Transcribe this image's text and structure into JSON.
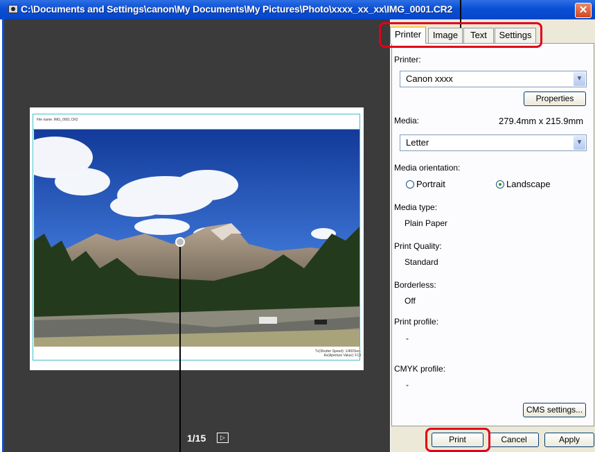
{
  "window": {
    "title": "C:\\Documents and Settings\\canon\\My Documents\\My Pictures\\Photo\\xxxx_xx_xx\\IMG_0001.CR2",
    "close_glyph": "✕"
  },
  "preview": {
    "sheet_header": "File name: IMG_0001.CR2",
    "exif_line1": "Tv(Shutter Speed): 1/400Sec.",
    "exif_line2": "Av(Aperture Value): F13",
    "pager_text": "1/15",
    "next_glyph": "▷"
  },
  "tabs": [
    {
      "label": "Printer",
      "active": true
    },
    {
      "label": "Image",
      "active": false
    },
    {
      "label": "Text",
      "active": false
    },
    {
      "label": "Settings",
      "active": false
    }
  ],
  "printer_tab": {
    "printer_label": "Printer:",
    "printer_value": "Canon xxxx",
    "properties_button": "Properties",
    "media_label": "Media:",
    "media_size": "279.4mm x 215.9mm",
    "media_value": "Letter",
    "orientation_label": "Media orientation:",
    "portrait_label": "Portrait",
    "landscape_label": "Landscape",
    "orientation_selected": "Landscape",
    "media_type_label": "Media type:",
    "media_type_value": "Plain Paper",
    "print_quality_label": "Print Quality:",
    "print_quality_value": "Standard",
    "borderless_label": "Borderless:",
    "borderless_value": "Off",
    "print_profile_label": "Print profile:",
    "print_profile_value": "-",
    "cmyk_profile_label": "CMYK profile:",
    "cmyk_profile_value": "-",
    "cms_button": "CMS settings..."
  },
  "footer": {
    "print_button": "Print",
    "cancel_button": "Cancel",
    "apply_button": "Apply"
  },
  "colors": {
    "titlebar": "#0a4fd6",
    "preview_bg": "#3b3b3b",
    "panel_bg": "#ece9d8",
    "callout": "#e0001a"
  }
}
